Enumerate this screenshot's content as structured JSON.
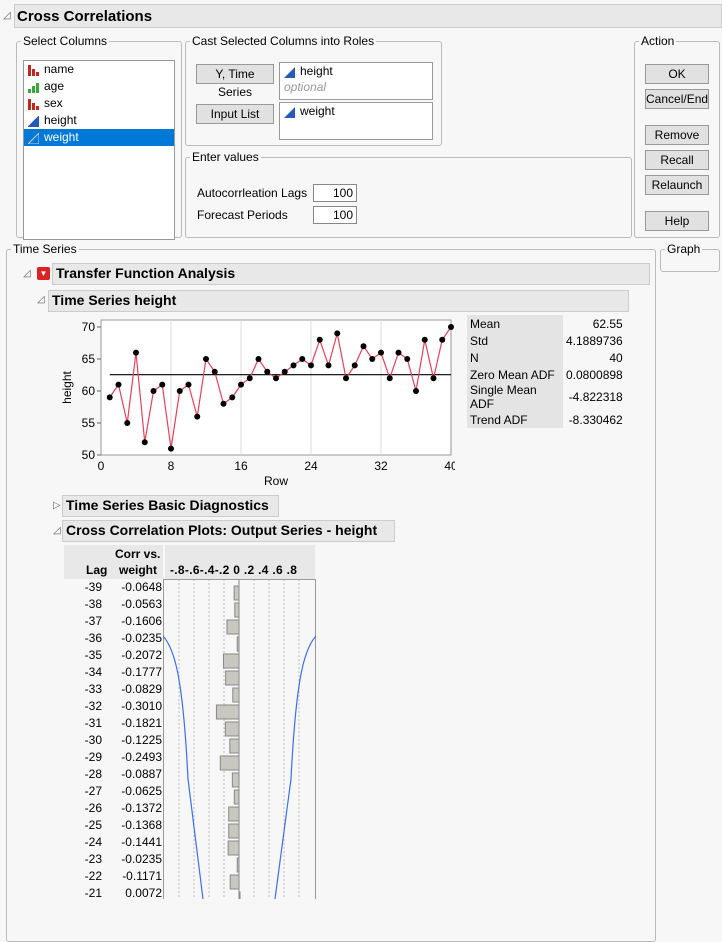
{
  "title": "Cross Correlations",
  "select_columns": {
    "legend": "Select Columns",
    "items": [
      {
        "label": "name",
        "icon": "nominal-icon",
        "color": "#c0281e"
      },
      {
        "label": "age",
        "icon": "ordinal-icon",
        "color": "#3aa83a"
      },
      {
        "label": "sex",
        "icon": "nominal-icon",
        "color": "#c0281e"
      },
      {
        "label": "height",
        "icon": "continuous-icon",
        "color": "#2a5ab8"
      },
      {
        "label": "weight",
        "icon": "continuous-icon",
        "color": "#2a5ab8",
        "selected": true
      }
    ]
  },
  "roles": {
    "legend": "Cast Selected Columns into Roles",
    "y_button": "Y, Time Series",
    "y_value": "height",
    "y_optional": "optional",
    "input_button": "Input List",
    "input_value": "weight"
  },
  "enter_values": {
    "legend": "Enter values",
    "autocorr_label": "Autocorrleation Lags",
    "autocorr_value": "100",
    "forecast_label": "Forecast Periods",
    "forecast_value": "100"
  },
  "action": {
    "legend": "Action",
    "ok": "OK",
    "cancel": "Cancel/End",
    "remove": "Remove",
    "recall": "Recall",
    "relaunch": "Relaunch",
    "help": "Help"
  },
  "time_series_legend": "Time Series",
  "graph_legend": "Graph",
  "tfa_title": "Transfer Function Analysis",
  "ts_title": "Time Series height",
  "stats": [
    [
      "Mean",
      "62.55"
    ],
    [
      "Std",
      "4.1889736"
    ],
    [
      "N",
      "40"
    ],
    [
      "Zero Mean ADF",
      "0.0800898"
    ],
    [
      "Single Mean ADF",
      "-4.822318"
    ],
    [
      "Trend ADF",
      "-8.330462"
    ]
  ],
  "diag_title": "Time Series Basic Diagnostics",
  "ccp_title": "Cross Correlation Plots: Output Series - height",
  "cc_headers": {
    "lag": "Lag",
    "corr1": "Corr vs.",
    "corr2": "weight",
    "axis": "-.8-.6-.4-.2 0 .2 .4 .6 .8"
  },
  "chart_data": {
    "type": "line",
    "title": "",
    "xlabel": "Row",
    "ylabel": "height",
    "xlim": [
      0,
      40
    ],
    "ylim": [
      50,
      70
    ],
    "xticks": [
      "0",
      "8",
      "16",
      "24",
      "32",
      "40"
    ],
    "yticks": [
      "50",
      "55",
      "60",
      "65",
      "70"
    ],
    "mean_line": 62.55,
    "x": [
      1,
      2,
      3,
      4,
      5,
      6,
      7,
      8,
      9,
      10,
      11,
      12,
      13,
      14,
      15,
      16,
      17,
      18,
      19,
      20,
      21,
      22,
      23,
      24,
      25,
      26,
      27,
      28,
      29,
      30,
      31,
      32,
      33,
      34,
      35,
      36,
      37,
      38,
      39,
      40
    ],
    "y": [
      59,
      61,
      55,
      66,
      52,
      60,
      61,
      51,
      60,
      61,
      56,
      65,
      63,
      58,
      59,
      61,
      62,
      65,
      63,
      62,
      63,
      64,
      65,
      64,
      68,
      64,
      69,
      62,
      64,
      67,
      65,
      66,
      62,
      66,
      65,
      60,
      68,
      62,
      68,
      70
    ]
  },
  "cross_corr": {
    "lags": [
      "-39",
      "-38",
      "-37",
      "-36",
      "-35",
      "-34",
      "-33",
      "-32",
      "-31",
      "-30",
      "-29",
      "-28",
      "-27",
      "-26",
      "-25",
      "-24",
      "-23",
      "-22",
      "-21"
    ],
    "values": [
      "-0.0648",
      "-0.0563",
      "-0.1606",
      "-0.0235",
      "-0.2072",
      "-0.1777",
      "-0.0829",
      "-0.3010",
      "-0.1821",
      "-0.1225",
      "-0.2493",
      "-0.0887",
      "-0.0625",
      "-0.1372",
      "-0.1368",
      "-0.1441",
      "-0.0235",
      "-0.1171",
      "0.0072"
    ]
  }
}
